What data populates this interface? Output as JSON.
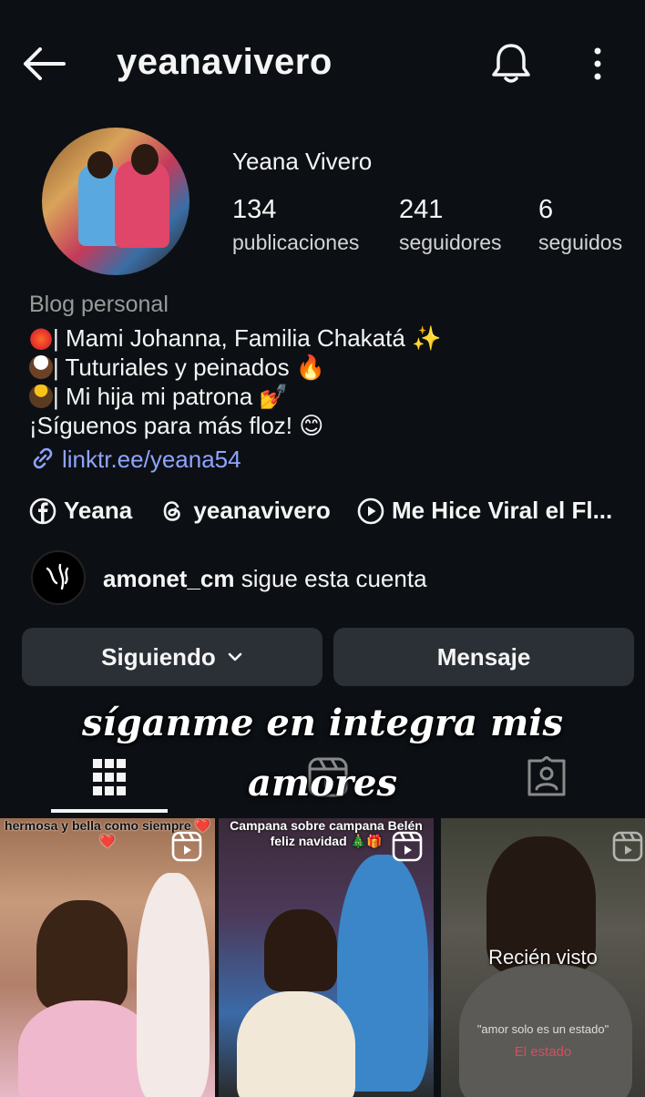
{
  "header": {
    "username": "yeanavivero"
  },
  "profile": {
    "display_name": "Yeana Vivero",
    "stats": [
      {
        "value": "134",
        "label": "publicaciones"
      },
      {
        "value": "241",
        "label": "seguidores"
      },
      {
        "value": "6",
        "label": "seguidos"
      }
    ],
    "category": "Blog personal",
    "bio_lines": [
      "| Mami Johanna, Familia Chakatá ✨",
      "| Tuturiales y peinados 🔥",
      "| Mi hija mi patrona 💅",
      " ¡Síguenos para más floz! 😊"
    ],
    "link": "linktr.ee/yeana54",
    "social": [
      {
        "icon": "facebook-icon",
        "label": "Yeana"
      },
      {
        "icon": "threads-icon",
        "label": "yeanavivero"
      },
      {
        "icon": "play-circle-icon",
        "label": "Me Hice Viral el Fl..."
      }
    ],
    "followed_by": {
      "user": "amonet_cm",
      "text": " sigue esta cuenta"
    }
  },
  "actions": {
    "following_label": "Siguiendo",
    "message_label": "Mensaje"
  },
  "overlay": {
    "line1": "síganme en integra mis",
    "line2": "amores"
  },
  "grid": {
    "items": [
      {
        "caption": "hermosa y bella como siempre ❤️❤️"
      },
      {
        "caption": "Campana sobre campana Belén feliz navidad 🎄🎁"
      },
      {
        "seen_label": "Recién visto",
        "caption_a": "\"amor solo es un estado\"",
        "caption_b": "El estado"
      }
    ]
  },
  "colors": {
    "background": "#0c1014",
    "button": "#2b3036",
    "link": "#8fa4ff",
    "muted": "#9a9a9a"
  }
}
